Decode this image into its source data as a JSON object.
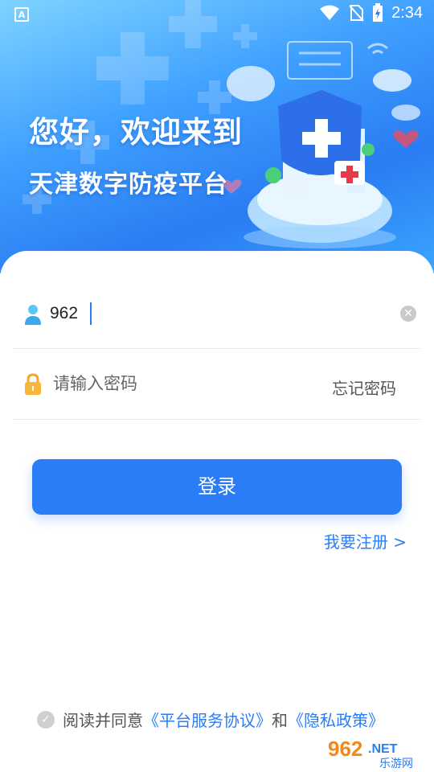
{
  "status_bar": {
    "notification_glyph": "A",
    "time": "2:34",
    "icons": [
      "wifi-icon",
      "no-sim-icon",
      "battery-charging-icon"
    ]
  },
  "hero": {
    "greeting_line1": "您好，欢迎来到",
    "greeting_line2": "天津数字防疫平台"
  },
  "login": {
    "username_value": "962",
    "password_placeholder": "请输入密码",
    "forgot_password": "忘记密码",
    "login_button": "登录",
    "register_link": "我要注册 >"
  },
  "agreement": {
    "prefix": "阅读并同意",
    "service_link": "《平台服务协议》",
    "conjunction": "和",
    "privacy_link": "《隐私政策》"
  },
  "watermark": {
    "brand_number": "962",
    "brand_suffix": ".NET",
    "brand_name": "乐游网"
  },
  "colors": {
    "accent": "#2a7df7",
    "hero_top": "#7fd3ff",
    "hero_bottom": "#2a7cf2"
  }
}
